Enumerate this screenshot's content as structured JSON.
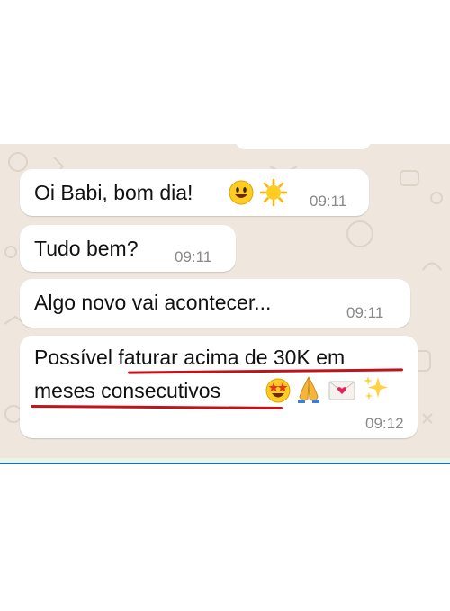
{
  "messages": [
    {
      "text": "Oi Babi, bom dia!",
      "time": "09:11",
      "emojis": [
        "smiling-face",
        "sun"
      ]
    },
    {
      "text": "Tudo bem?",
      "time": "09:11"
    },
    {
      "text": "Algo novo vai acontecer...",
      "time": "09:11"
    },
    {
      "line1": "Possível faturar acima de 30K em",
      "line2": "meses consecutivos",
      "time": "09:12",
      "emojis": [
        "star-struck",
        "folded-hands",
        "love-letter",
        "sparkles"
      ]
    }
  ],
  "colors": {
    "chat_background": "#efe7de",
    "bubble": "#ffffff",
    "timestamp": "#8a8a8a",
    "underline": "#c0141c"
  }
}
